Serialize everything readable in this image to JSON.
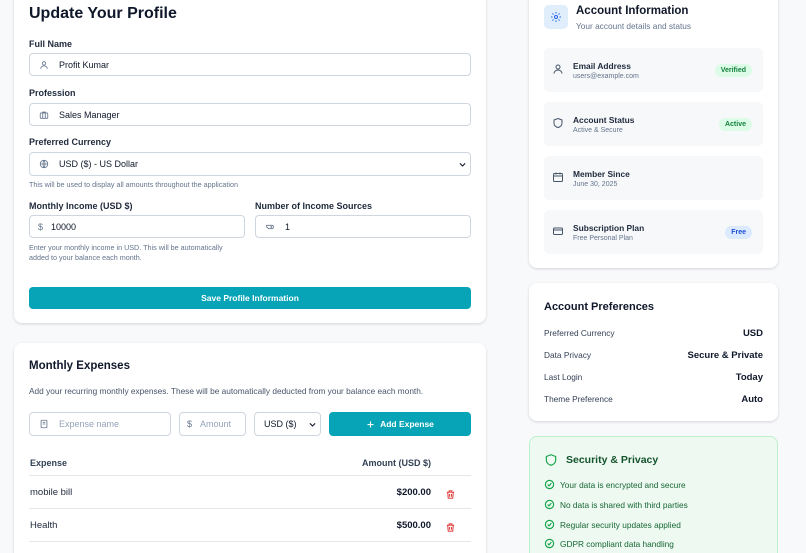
{
  "profile": {
    "title": "Update Your Profile",
    "full_name_label": "Full Name",
    "full_name_value": "Profit Kumar",
    "profession_label": "Profession",
    "profession_value": "Sales Manager",
    "currency_label": "Preferred Currency",
    "currency_value": "USD ($) - US Dollar",
    "currency_hint": "This will be used to display all amounts throughout the application",
    "income_label": "Monthly Income (USD $)",
    "income_prefix": "$",
    "income_value": "10000",
    "income_hint_line1": "Enter your monthly income in USD. This will be automatically",
    "income_hint_line2": "added to your balance each month.",
    "sources_label": "Number of Income Sources",
    "sources_value": "1",
    "save_label": "Save Profile Information"
  },
  "expenses": {
    "title": "Monthly Expenses",
    "description": "Add your recurring monthly expenses. These will be automatically deducted from your balance each month.",
    "name_placeholder": "Expense name",
    "amount_prefix": "$",
    "amount_placeholder": "Amount",
    "currency_value": "USD ($)",
    "add_label": "Add Expense",
    "col_expense": "Expense",
    "col_amount": "Amount (USD $)",
    "rows": [
      {
        "name": "mobile bill",
        "amount": "$200.00"
      },
      {
        "name": "Health",
        "amount": "$500.00"
      }
    ]
  },
  "account": {
    "title": "Account Information",
    "subtitle": "Your account details and status",
    "items": [
      {
        "title": "Email Address",
        "sub": "users@example.com",
        "badge": "Verified",
        "icon": "mail-icon"
      },
      {
        "title": "Account Status",
        "sub": "Active & Secure",
        "badge": "Active",
        "icon": "shield-icon"
      },
      {
        "title": "Member Since",
        "sub": "June 30, 2025",
        "icon": "calendar-icon"
      },
      {
        "title": "Subscription Plan",
        "sub": "Free Personal Plan",
        "badge": "Free",
        "icon": "credit-card-icon"
      }
    ]
  },
  "preferences": {
    "title": "Account Preferences",
    "rows": [
      {
        "key": "Preferred Currency",
        "value": "USD"
      },
      {
        "key": "Data Privacy",
        "value": "Secure & Private"
      },
      {
        "key": "Last Login",
        "value": "Today"
      },
      {
        "key": "Theme Preference",
        "value": "Auto"
      }
    ]
  },
  "security": {
    "title": "Security & Privacy",
    "items": [
      "Your data is encrypted and secure",
      "No data is shared with third parties",
      "Regular security updates applied",
      "GDPR compliant data handling"
    ]
  },
  "colors": {
    "accent": "#06a4b6",
    "verified_bg": "#dcfce7",
    "verified_text": "#15803d",
    "free_bg": "#dbeafe",
    "free_text": "#1d4ed8",
    "security_bg": "#eefaf1",
    "delete": "#dc2626"
  }
}
